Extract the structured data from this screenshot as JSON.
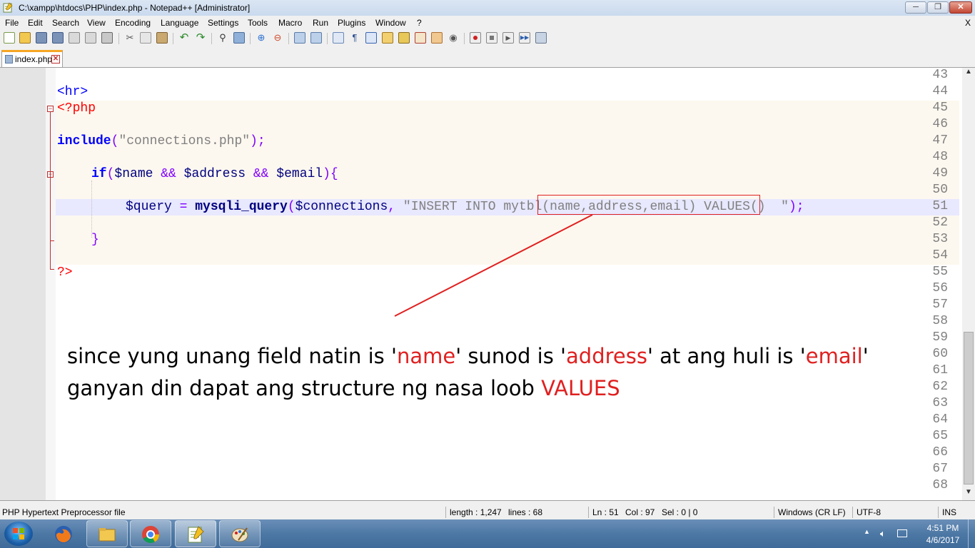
{
  "window": {
    "title": "C:\\xampp\\htdocs\\PHP\\index.php - Notepad++ [Administrator]",
    "min_label": "─",
    "max_label": "❐",
    "close_label": "✕"
  },
  "menu": {
    "items": [
      "File",
      "Edit",
      "Search",
      "View",
      "Encoding",
      "Language",
      "Settings",
      "Tools",
      "Macro",
      "Run",
      "Plugins",
      "Window",
      "?"
    ],
    "close_doc": "X"
  },
  "tabs": [
    {
      "label": "index.php",
      "close": "✕",
      "active": true
    }
  ],
  "editor": {
    "line_numbers": [
      "43",
      "44",
      "45",
      "46",
      "47",
      "48",
      "49",
      "50",
      "51",
      "52",
      "53",
      "54",
      "55",
      "56",
      "57",
      "58",
      "59",
      "60",
      "61",
      "62",
      "63",
      "64",
      "65",
      "66",
      "67",
      "68"
    ],
    "code": {
      "l44": "<hr>",
      "l45": "<?php",
      "l47_kw": "include",
      "l47_p1": "(",
      "l47_str": "\"connections.php\"",
      "l47_p2": ");",
      "l49_kw": "if",
      "l49_p1": "(",
      "l49_v1": "$name",
      "l49_op1": " && ",
      "l49_v2": "$address",
      "l49_op2": " && ",
      "l49_v3": "$email",
      "l49_p2": "){",
      "l51_v1": "$query",
      "l51_op": " = ",
      "l51_fn": "mysqli_query",
      "l51_p1": "(",
      "l51_v2": "$connections",
      "l51_comma": ", ",
      "l51_str": "\"INSERT INTO mytbl(name,address,email) VALUES()  \"",
      "l51_p2": ");",
      "l53": "}",
      "l55": "?>"
    }
  },
  "annotation": {
    "line1_a": "since yung unang field natin is  '",
    "line1_name": "name",
    "line1_b": "' sunod is '",
    "line1_address": "address",
    "line1_c": "' at ang huli is '",
    "line1_email": "email",
    "line1_d": "'",
    "line2_a": "ganyan din dapat ang structure ng nasa loob ",
    "line2_values": "VALUES"
  },
  "status": {
    "filetype": "PHP Hypertext Preprocessor file",
    "length": "length : 1,247",
    "lines": "lines : 68",
    "ln": "Ln : 51",
    "col": "Col : 97",
    "sel": "Sel : 0 | 0",
    "eol": "Windows (CR LF)",
    "encoding": "UTF-8",
    "mode": "INS"
  },
  "taskbar": {
    "time": "4:51 PM",
    "date": "4/6/2017"
  },
  "colors": {
    "highlight_red": "#e02020",
    "keyword_blue": "#0000ff",
    "string_gray": "#808080"
  }
}
